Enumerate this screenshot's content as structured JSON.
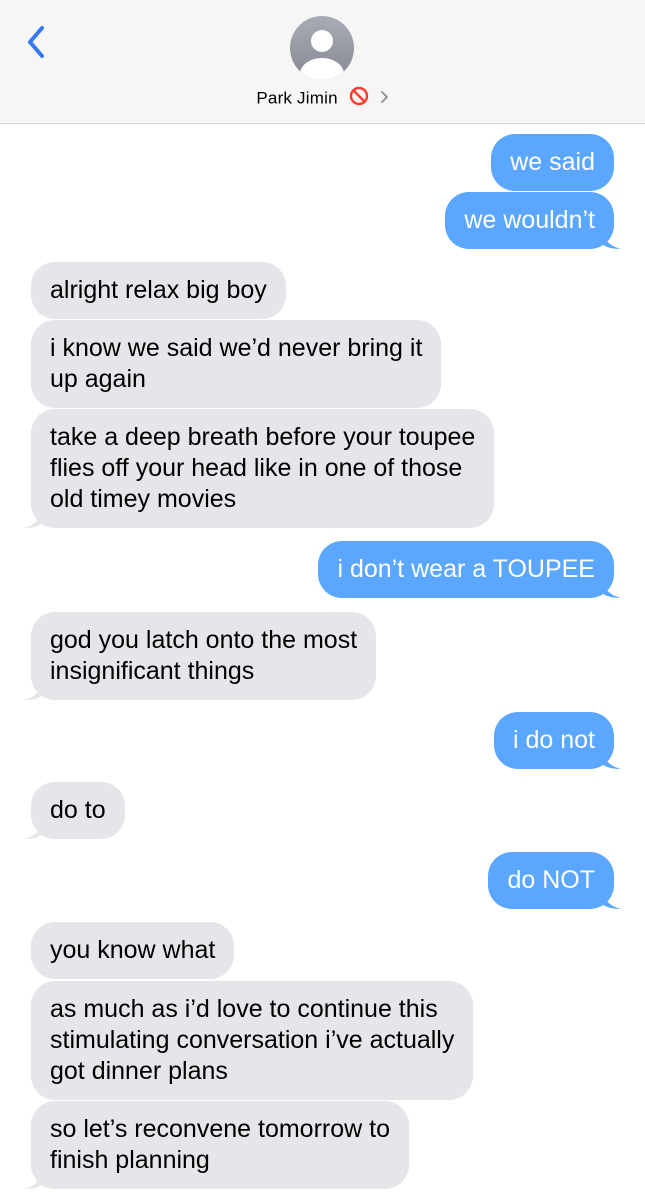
{
  "header": {
    "contact_name": "Park Jimin",
    "status_icon": "no-entry-icon",
    "back_icon": "chevron-left-icon",
    "avatar_icon": "person-silhouette-icon",
    "accent": "#3478f6"
  },
  "messages": [
    {
      "from": "me",
      "text": "we said"
    },
    {
      "from": "me",
      "text": "we wouldn’t"
    },
    {
      "from": "them",
      "text": "alright relax big boy"
    },
    {
      "from": "them",
      "lines": [
        "i know we said we’d never bring it",
        "up again"
      ]
    },
    {
      "from": "them",
      "lines": [
        "take a deep breath before your toupee",
        "flies off your head like in one of those",
        "old timey movies"
      ]
    },
    {
      "from": "me",
      "text": "i don’t wear a TOUPEE"
    },
    {
      "from": "them",
      "lines": [
        "god you latch onto the most",
        "insignificant things"
      ]
    },
    {
      "from": "me",
      "text": "i do not"
    },
    {
      "from": "them",
      "text": "do to"
    },
    {
      "from": "me",
      "text": "do NOT"
    },
    {
      "from": "them",
      "text": "you know what"
    },
    {
      "from": "them",
      "lines": [
        "as much as i’d love to continue this",
        "stimulating conversation i’ve actually",
        "got dinner plans"
      ]
    },
    {
      "from": "them",
      "lines": [
        "so let’s reconvene tomorrow to",
        "finish planning"
      ]
    }
  ],
  "colors": {
    "sent_bubble": "#5ba6ff",
    "received_bubble": "#e5e5ea"
  }
}
